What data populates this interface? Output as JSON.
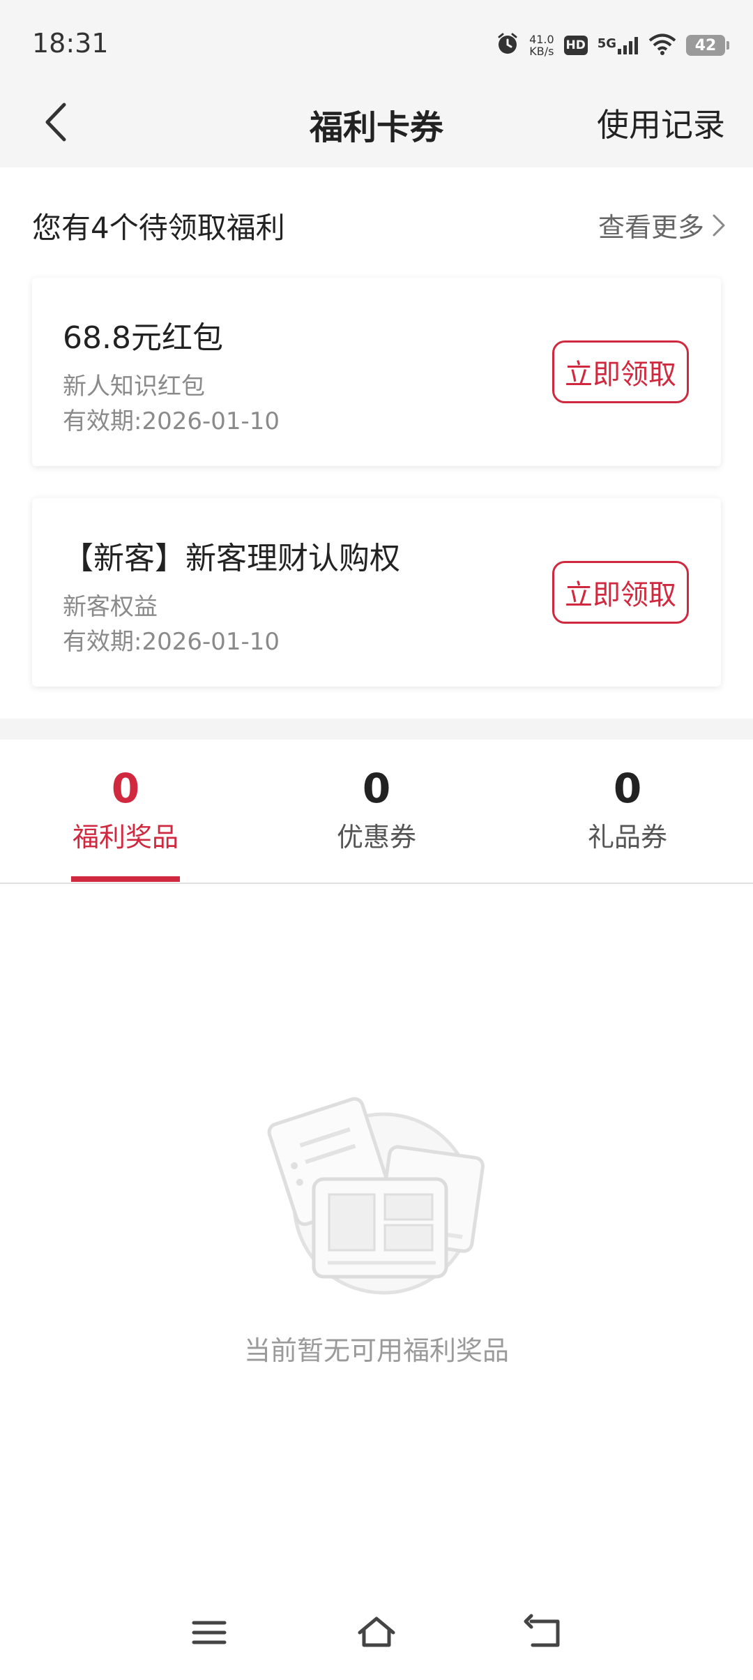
{
  "status_bar": {
    "time": "18:31",
    "net_speed_value": "41.0",
    "net_speed_unit": "KB/s",
    "hd": "HD",
    "network": "5G",
    "battery": "42"
  },
  "header": {
    "title": "福利卡券",
    "history_label": "使用记录"
  },
  "pending": {
    "title": "您有4个待领取福利",
    "more_label": "查看更多"
  },
  "cards": [
    {
      "title": "68.8元红包",
      "subtitle": "新人知识红包",
      "validity": "有效期:2026-01-10",
      "button": "立即领取"
    },
    {
      "title": "【新客】新客理财认购权",
      "subtitle": "新客权益",
      "validity": "有效期:2026-01-10",
      "button": "立即领取"
    }
  ],
  "tabs": [
    {
      "count": "0",
      "label": "福利奖品",
      "active": true
    },
    {
      "count": "0",
      "label": "优惠券",
      "active": false
    },
    {
      "count": "0",
      "label": "礼品券",
      "active": false
    }
  ],
  "empty_state": {
    "text": "当前暂无可用福利奖品"
  },
  "colors": {
    "accent": "#d0293f",
    "header_bg": "#f5f5f5"
  }
}
